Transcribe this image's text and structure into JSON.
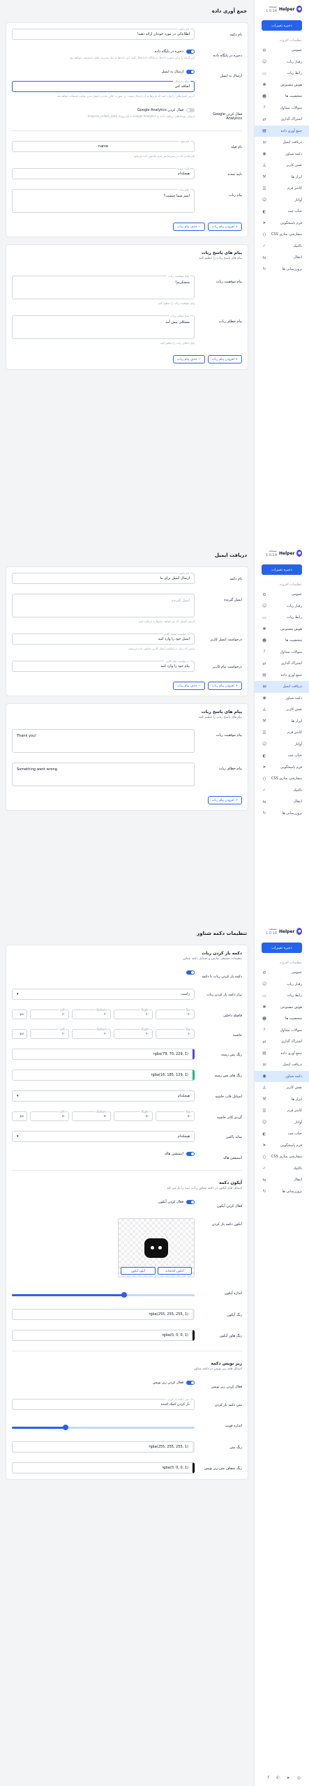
{
  "sidebar": {
    "app_name": "Helper",
    "version_label": "نسخه 1.0.14",
    "update_button": "ذخیره تغییرات",
    "section_label": "تنظیمات افزونه",
    "items": [
      {
        "label": "عمومی",
        "icon": "gear-icon",
        "glyph": "⚙"
      },
      {
        "label": "رفتار ربات",
        "icon": "robot-icon",
        "glyph": "☺"
      },
      {
        "label": "رابط ربات",
        "icon": "chat-icon",
        "glyph": "▭"
      },
      {
        "label": "هوش مصنوعی",
        "icon": "brain-icon",
        "glyph": "✱"
      },
      {
        "label": "شخصیت ها",
        "icon": "user-icon",
        "glyph": "☻"
      },
      {
        "label": "سوالات متداول",
        "icon": "question-icon",
        "glyph": "?"
      },
      {
        "label": "اشتراک گذاری",
        "icon": "share-icon",
        "glyph": "⇄"
      },
      {
        "label": "جمع آوری داده",
        "icon": "database-icon",
        "glyph": "▤"
      },
      {
        "label": "دریافت ایمیل",
        "icon": "mail-icon",
        "glyph": "✉"
      },
      {
        "label": "دکمه شناور",
        "icon": "float-icon",
        "glyph": "◉"
      },
      {
        "label": "نقش کاربر",
        "icon": "role-icon",
        "glyph": "♙"
      },
      {
        "label": "ابزار ها",
        "icon": "tools-icon",
        "glyph": "⚒"
      },
      {
        "label": "کانتنر فرم",
        "icon": "form-icon",
        "glyph": "☰"
      },
      {
        "label": "آواتار",
        "icon": "avatar-icon",
        "glyph": "☺"
      },
      {
        "label": "حباب چت",
        "icon": "bubble-icon",
        "glyph": "◐"
      },
      {
        "label": "فرم پاسخگویی",
        "icon": "send-icon",
        "glyph": "➤"
      },
      {
        "label": "سفارشی سازی CSS",
        "icon": "code-icon",
        "glyph": "⟨⟩"
      },
      {
        "label": "تاکتیک",
        "icon": "tactic-icon",
        "glyph": "✓"
      },
      {
        "label": "انتقال",
        "icon": "transfer-icon",
        "glyph": "⇆"
      },
      {
        "label": "بروزرسانی ها",
        "icon": "update-icon",
        "glyph": "↻"
      }
    ],
    "social": [
      "instagram-icon",
      "telegram-icon",
      "whatsapp-icon",
      "facebook-icon"
    ]
  },
  "panel1": {
    "title": "جمع آوری داده",
    "fields": [
      {
        "label": "نام دکمه",
        "float": "نام دکمه",
        "value": "اطلاعاتی در مورد خودتان ارائه دهید!"
      },
      {
        "label": "ذخیره در پایگاه داده",
        "toggle": "ذخیره در پایگاه داده",
        "help": "این گزینه را برای ذخیره داده‌ها در پایگاه داده فعال کنید. این داده‌ها در پنل مدیریت قابل دسترسی خواهند بود."
      },
      {
        "label": "ارسال به ایمیل",
        "toggle": "ارسال به ایمیل",
        "float": "حالت ارسال",
        "value": "اضافه کنن",
        "help": "آدرس ایمیل‌هایی را وارد کنید که فرم‌ها به آن ارسال شوند. در صورت خالی ماندن، ایمیل مدیر سایت استفاده خواهد شد"
      },
      {
        "label": "فعال کردن Google Analytics",
        "toggle": "فعال کردن Google Analytics",
        "help": "ارسال رویدادهای دریافت داده به Google Analytics با نام رویداد helperai_collect_data"
      },
      {
        "label": "نام فیلد",
        "float": "نام فیلد",
        "value": "name",
        "help": "نام فیلدی که در پیش‌نمایش فرم نمایش داده می‌شود"
      },
      {
        "label": "تایید شدند",
        "float": "تایید شدند",
        "value": "هیچکدام"
      },
      {
        "label": "پیام ربات",
        "float": "پیام ربات",
        "value": "اسم شما چیست؟"
      }
    ],
    "buttons": [
      "افزودن پیام ربات",
      "حذف پیام ربات"
    ],
    "response_title": "پیام های پاسخ ربات",
    "response_sub": "پیام های پاسخ ربات را تنظیم کنید",
    "success_label": "پیام موفقیت ربات",
    "success_value": "متشکریم!",
    "success_help": "پیام موفقیت ربات را تنظیم کنید",
    "error_label": "پیام خطای ربات",
    "error_value": "مشکلی پیش آمد",
    "error_help": "پیام خطای ربات را تنظیم کنید",
    "bottom_buttons": [
      "افزودن پیام ربات",
      "حذف پیام ربات"
    ]
  },
  "panel2": {
    "title": "دریافت ایمیل",
    "fields": [
      {
        "label": "نام دکمه",
        "float": "نام دکمه",
        "value": "ارسال ایمیل برای ما"
      },
      {
        "label": "ایمیل گیرنده",
        "float": "",
        "value": "ایمیل گیرنده",
        "help": "آدرس ایمیلی که می‌خواهید پیام‌ها را دریافت کنید"
      },
      {
        "label": "درخواست ایمیل کاربر",
        "float": "درخواست ایمیل کاربر",
        "value": "ایمیل خود را وارد کنید",
        "help": "پیامی که برای درخواست ایمیل کاربر نمایش داده می‌شود"
      },
      {
        "label": "درخواست پیام کاربر",
        "float": "درخواست پیام کاربر",
        "value": "پیام خود را وارد کنید"
      }
    ],
    "buttons": [
      "افزودن پیام ربات",
      "حذف پیام ربات"
    ],
    "response_title": "پیام های پاسخ ربات",
    "response_sub": "پیام های پاسخ ربات را تنظیم کنید",
    "success_label": "پیام موفقیت ربات",
    "success_value": "Thank you!",
    "error_label": "پیام خطای ربات",
    "error_value": "Something went wrong",
    "bottom_buttons": [
      "افزودن پیام ربات"
    ]
  },
  "panel3": {
    "title": "تنظیمات دکمه شناور",
    "card_title": "دکمه باز کردن ربات",
    "card_sub": "تنظیمات مستقل نمایش و استایل دکمه شناور",
    "open_label": "دکمه باز کردن ربات با دکمه",
    "pos_label": "تراز دکمه باز کردن ربات",
    "pos_value": "راست",
    "spacing_label": "فاصله داخلی",
    "margin_label": "حاشیه",
    "box_labels": [
      "Top",
      "Right",
      "Bottom",
      "Left"
    ],
    "box_values": [
      "۲۰",
      "۲۰",
      "۲۰",
      "۲۰"
    ],
    "unit": "px",
    "bg_label": "رنگ پس زمینه",
    "bg_value": "rgba(79, 70, 229, 1)",
    "bghover_label": "رنگ های پس زمینه",
    "bghover_value": "rgba(16, 185, 129, 1)",
    "frame_label": "استایل قاب حاشیه",
    "frame_value": "هیچکدام",
    "radius_label": "گردی کادر حاشیه",
    "radius_values": [
      "۵۰",
      "۵۰",
      "۵۰",
      "۵۰"
    ],
    "shadow_label": "سایه باکس",
    "shadow_value": "هیچکدام",
    "anim_label": "انیمیشن هاله",
    "anim_toggle": "انیمیشن هاله",
    "icon_title": "آیکون دکمه",
    "icon_sub": "استایل های آیکون در دکمه شناور ربات، ثبت را باز می کند",
    "icon_enable": "فعال کردن آیکون",
    "icon_label": "آیکون دکمه باز کردن",
    "icon_btns": [
      "آیکون کتابخانه",
      "آپلود آیکون"
    ],
    "icon_size_label": "اندازه آیکون",
    "icon_color_label": "رنگ آیکون",
    "icon_color_value": "rgba(255, 255, 255, 1)",
    "icon_hover_label": "رنگ هاور آیکون",
    "icon_hover_value": "rgba(0, 0, 0, 1)",
    "sub_title": "زیر نویس دکمه",
    "sub_sub": "استایل های زیر نویس در دکمه شناور",
    "sub_enable": "فعال کردن زیر نویس",
    "sub_text_label": "متن دکمه باز کردن",
    "sub_text_value": "باز کردن کمک کننده",
    "font_label": "اندازه فونت",
    "text_color_label": "رنگ متن",
    "text_color_value": "rgba(255, 255, 255, 1)",
    "bg_sub_label": "رنگ شفاف متن زیر نویس",
    "bg_sub_value": "rgba(0, 0, 0, 1)"
  }
}
